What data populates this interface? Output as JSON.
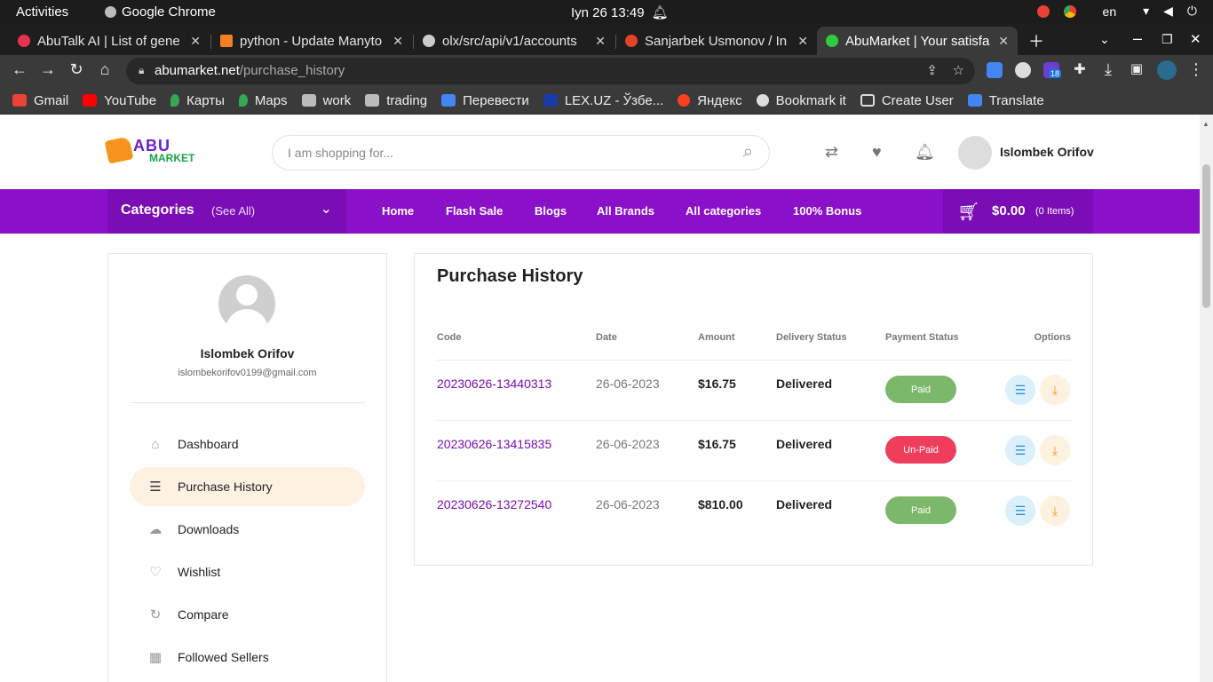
{
  "system_bar": {
    "activities": "Activities",
    "app_name": "Google Chrome",
    "clock": "Iyn 26  13:49",
    "lang": "en"
  },
  "tabs": [
    {
      "title": "AbuTalk AI | List of gene",
      "color": "#e8334e"
    },
    {
      "title": "python - Update Manyto",
      "color": "#f48024"
    },
    {
      "title": "olx/src/api/v1/accounts",
      "color": "#cccccc"
    },
    {
      "title": "Sanjarbek Usmonov / In",
      "color": "#e24329"
    },
    {
      "title": "AbuMarket | Your satisfa",
      "color": "#2ecc40"
    }
  ],
  "omnibox": {
    "domain": "abumarket.net",
    "path": "/purchase_history"
  },
  "ext_badge": "18",
  "bookmarks": [
    {
      "label": "Gmail",
      "color": "#ea4335"
    },
    {
      "label": "YouTube",
      "color": "#ff0000"
    },
    {
      "label": "Карты",
      "color": "#34a853"
    },
    {
      "label": "Maps",
      "color": "#34a853"
    },
    {
      "label": "work",
      "color": "#bbbbbb"
    },
    {
      "label": "trading",
      "color": "#bbbbbb"
    },
    {
      "label": "Перевести",
      "color": "#4285f4"
    },
    {
      "label": "LEX.UZ - Ўзбе...",
      "color": "#1a3aa8"
    },
    {
      "label": "Яндекс",
      "color": "#fc3f1d"
    },
    {
      "label": "Bookmark it",
      "color": "#dddddd"
    },
    {
      "label": "Create User",
      "color": "#dddddd"
    },
    {
      "label": "Translate",
      "color": "#4285f4"
    }
  ],
  "site": {
    "logo_top": "ABU",
    "logo_bottom": "MARKET",
    "search_placeholder": "I am shopping for...",
    "user_name": "Islombek Orifov"
  },
  "nav": {
    "categories": "Categories",
    "see_all": "(See All)",
    "links": [
      "Home",
      "Flash Sale",
      "Blogs",
      "All Brands",
      "All categories",
      "100% Bonus"
    ],
    "cart_amount": "$0.00",
    "cart_items": "(0 Items)"
  },
  "sidebar": {
    "name": "Islombek Orifov",
    "email": "islombekorifov0199@gmail.com",
    "items": [
      {
        "label": "Dashboard",
        "icon": "home-icon"
      },
      {
        "label": "Purchase History",
        "icon": "list-icon"
      },
      {
        "label": "Downloads",
        "icon": "cloud-download-icon"
      },
      {
        "label": "Wishlist",
        "icon": "heart-icon"
      },
      {
        "label": "Compare",
        "icon": "refresh-icon"
      },
      {
        "label": "Followed Sellers",
        "icon": "store-icon"
      }
    ]
  },
  "purchase": {
    "title": "Purchase History",
    "headers": {
      "code": "Code",
      "date": "Date",
      "amount": "Amount",
      "delivery": "Delivery Status",
      "payment": "Payment Status",
      "options": "Options"
    },
    "rows": [
      {
        "code": "20230626-13440313",
        "date": "26-06-2023",
        "amount": "$16.75",
        "delivery": "Delivered",
        "payment": "Paid"
      },
      {
        "code": "20230626-13415835",
        "date": "26-06-2023",
        "amount": "$16.75",
        "delivery": "Delivered",
        "payment": "Un-Paid"
      },
      {
        "code": "20230626-13272540",
        "date": "26-06-2023",
        "amount": "$810.00",
        "delivery": "Delivered",
        "payment": "Paid"
      }
    ]
  }
}
